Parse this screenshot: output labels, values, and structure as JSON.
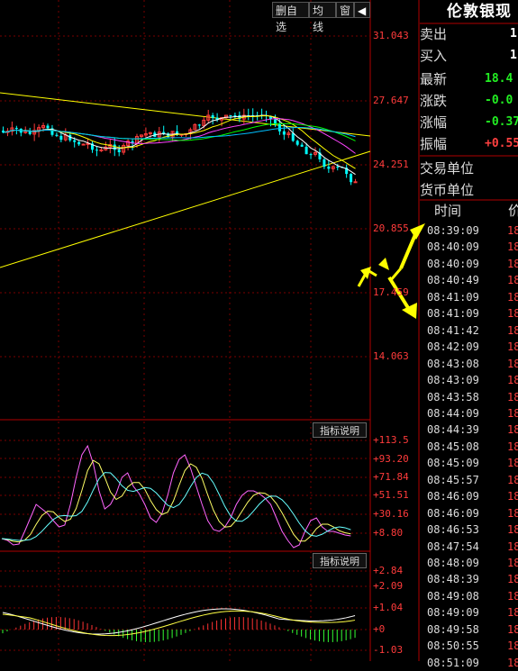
{
  "toolbar": {
    "delete_self_select": "删自选",
    "avg_line": "均线",
    "window": "窗",
    "arrow": "◀"
  },
  "price_axis": [
    "31.043",
    "27.647",
    "24.251",
    "20.855",
    "17.459",
    "14.063"
  ],
  "indicator1": {
    "button": "指标说明",
    "axis": [
      "+113.5",
      "+93.20",
      "+71.84",
      "+51.51",
      "+30.16",
      "+8.80"
    ]
  },
  "indicator2": {
    "button": "指标说明",
    "axis": [
      "+2.84",
      "+2.09",
      "+1.04",
      "+0",
      "-1.03"
    ]
  },
  "quote": {
    "title": "伦敦银现",
    "rows": [
      {
        "label": "卖出",
        "value": "1",
        "color": "#ffffff"
      },
      {
        "label": "买入",
        "value": "1",
        "color": "#ffffff"
      },
      {
        "label": "最新",
        "value": "18.4",
        "color": "#22ee22"
      },
      {
        "label": "涨跌",
        "value": "-0.0",
        "color": "#22ee22"
      },
      {
        "label": "涨幅",
        "value": "-0.37",
        "color": "#22ee22"
      },
      {
        "label": "振幅",
        "value": "+0.55",
        "color": "#ff4040"
      },
      {
        "label": "交易单位",
        "value": "",
        "color": "#ffffff"
      },
      {
        "label": "货币单位",
        "value": "",
        "color": "#ffffff"
      }
    ]
  },
  "trades": {
    "header_time": "时间",
    "header_price": "价",
    "times": [
      "08:39:09",
      "08:40:09",
      "08:40:09",
      "08:40:49",
      "08:41:09",
      "08:41:09",
      "08:41:42",
      "08:42:09",
      "08:43:08",
      "08:43:09",
      "08:43:58",
      "08:44:09",
      "08:44:39",
      "08:45:08",
      "08:45:09",
      "08:45:57",
      "08:46:09",
      "08:46:09",
      "08:46:53",
      "08:47:54",
      "08:48:09",
      "08:48:39",
      "08:49:08",
      "08:49:09",
      "08:49:58",
      "08:50:55",
      "08:51:09"
    ],
    "price_prefix": "18"
  },
  "colors": {
    "up": "#ff3b3b",
    "down": "#00ffff",
    "grid": "#7a0000",
    "yellow": "#ffff00"
  }
}
